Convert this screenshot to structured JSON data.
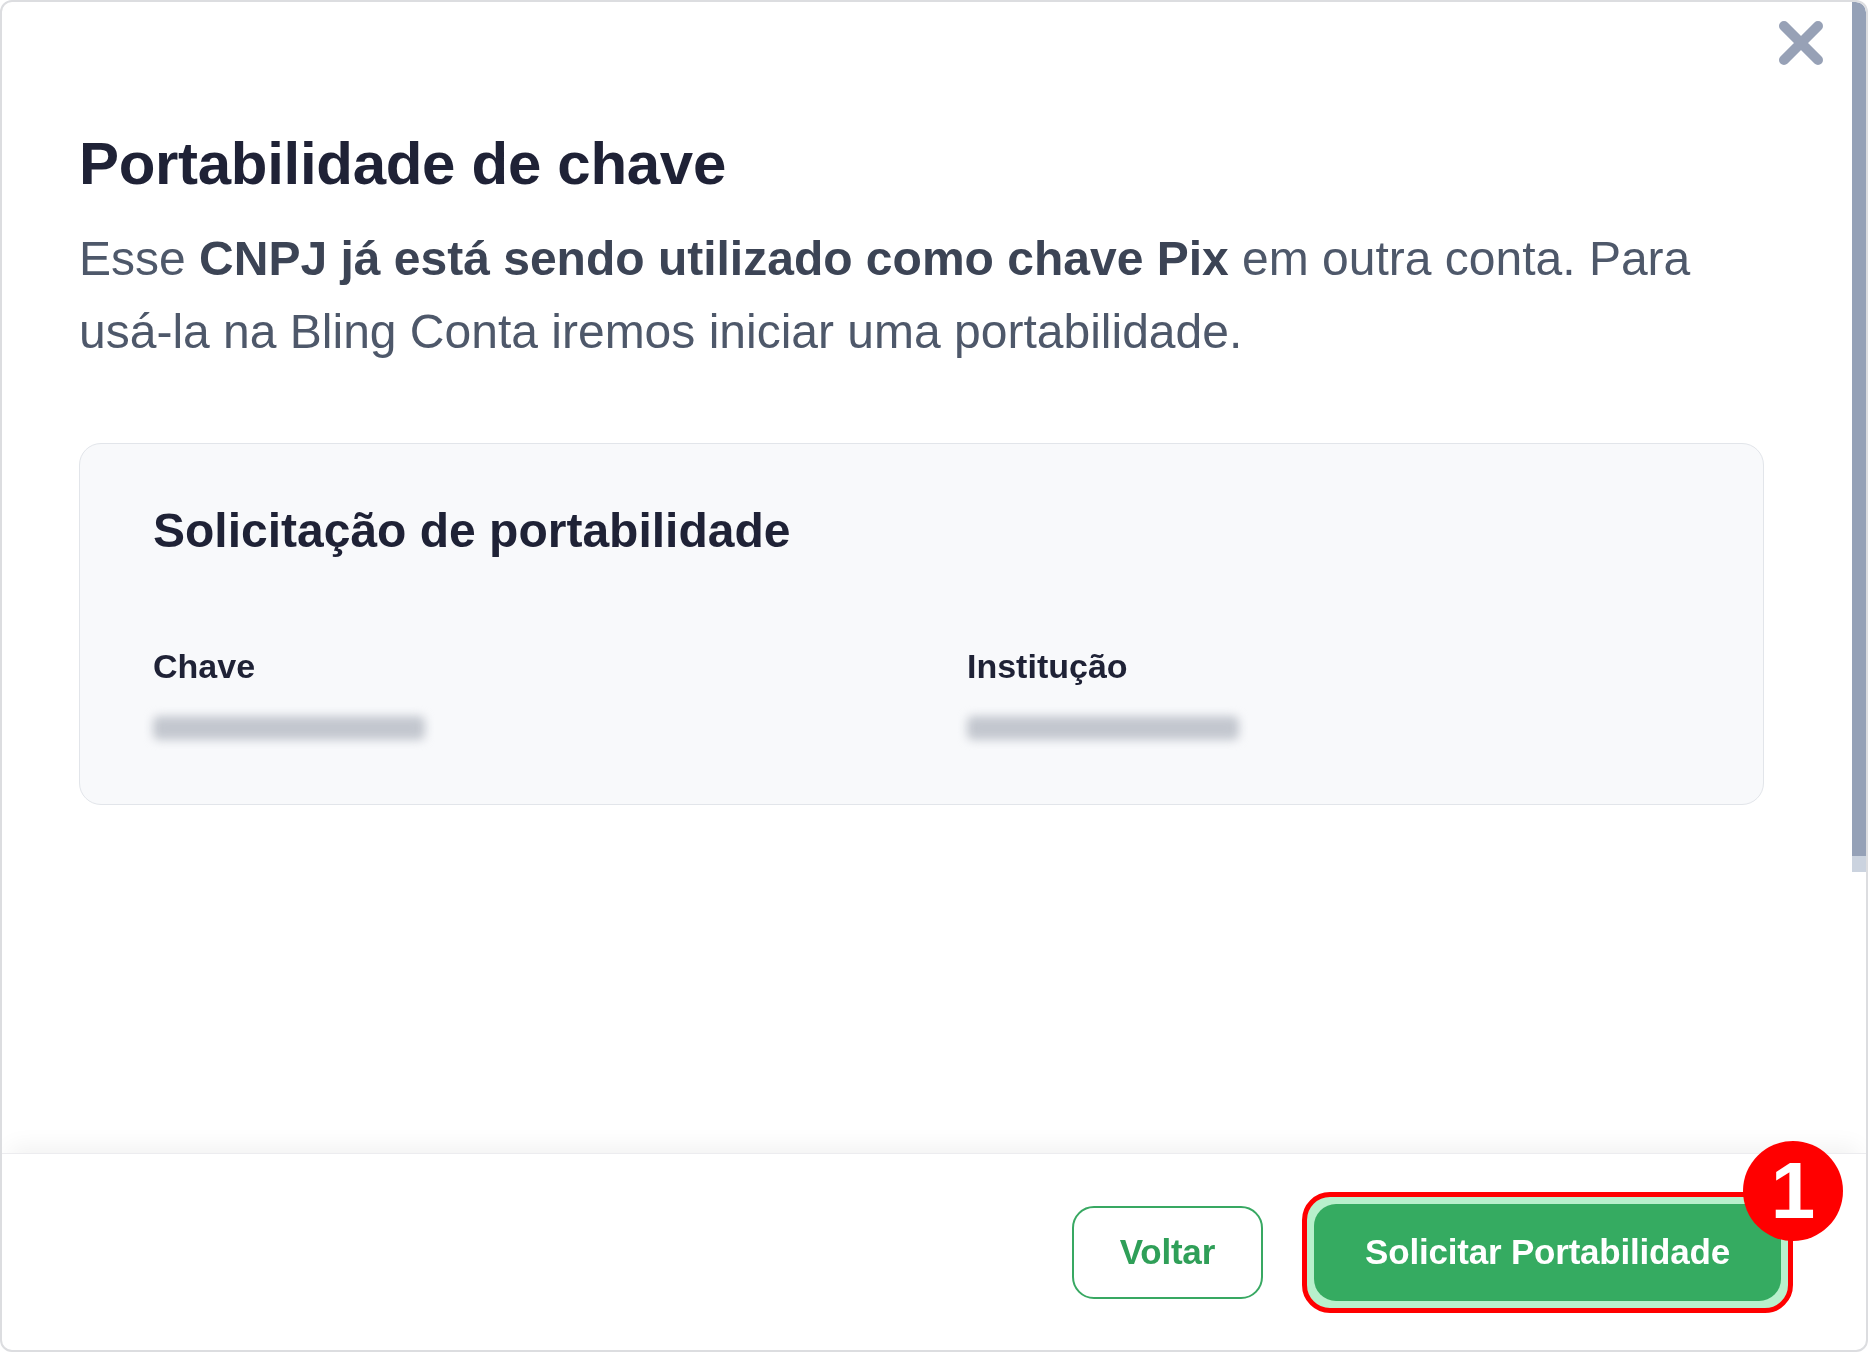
{
  "dialog": {
    "title": "Portabilidade de chave",
    "message": "Esse **CNPJ já está sendo utilizado como chave Pix** em outra conta. Para usá-la na Bling Conta iremos iniciar uma portabilidade.",
    "request_card": {
      "title": "Solicitação de portabilidade",
      "fields": [
        {
          "label": "Chave",
          "redacted": true
        },
        {
          "label": "Institução",
          "redacted": true
        }
      ]
    },
    "buttons": [
      {
        "label": "Voltar",
        "kind": "secondary",
        "focused": false
      },
      {
        "label": "Solicitar Portabilidade",
        "kind": "primary",
        "focused": true,
        "annotation": {
          "badge": "1"
        }
      }
    ]
  }
}
